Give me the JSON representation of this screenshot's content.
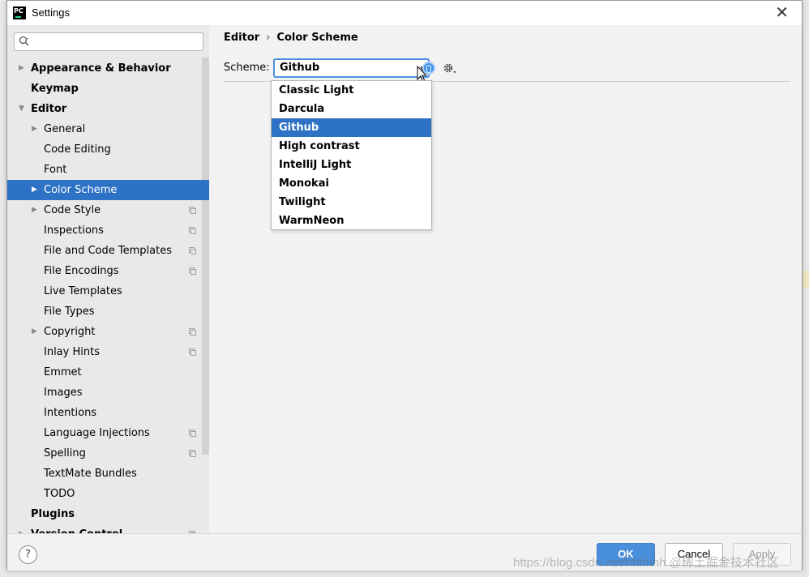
{
  "window": {
    "title": "Settings",
    "app_icon_text": "PC",
    "close_glyph": "✕"
  },
  "search": {
    "placeholder": "",
    "icon": "search-icon"
  },
  "tree": [
    {
      "label": "Appearance & Behavior",
      "bold": true,
      "arrow": "▶",
      "level": 0
    },
    {
      "label": "Keymap",
      "bold": true,
      "arrow": "",
      "level": 0
    },
    {
      "label": "Editor",
      "bold": true,
      "arrow": "▼",
      "level": 0
    },
    {
      "label": "General",
      "bold": false,
      "arrow": "▶",
      "level": 1
    },
    {
      "label": "Code Editing",
      "bold": false,
      "arrow": "",
      "level": 1
    },
    {
      "label": "Font",
      "bold": false,
      "arrow": "",
      "level": 1
    },
    {
      "label": "Color Scheme",
      "bold": false,
      "arrow": "▶",
      "level": 1,
      "selected": true
    },
    {
      "label": "Code Style",
      "bold": false,
      "arrow": "▶",
      "level": 1,
      "copy": true
    },
    {
      "label": "Inspections",
      "bold": false,
      "arrow": "",
      "level": 1,
      "copy": true
    },
    {
      "label": "File and Code Templates",
      "bold": false,
      "arrow": "",
      "level": 1,
      "copy": true
    },
    {
      "label": "File Encodings",
      "bold": false,
      "arrow": "",
      "level": 1,
      "copy": true
    },
    {
      "label": "Live Templates",
      "bold": false,
      "arrow": "",
      "level": 1
    },
    {
      "label": "File Types",
      "bold": false,
      "arrow": "",
      "level": 1
    },
    {
      "label": "Copyright",
      "bold": false,
      "arrow": "▶",
      "level": 1,
      "copy": true
    },
    {
      "label": "Inlay Hints",
      "bold": false,
      "arrow": "",
      "level": 1,
      "copy": true
    },
    {
      "label": "Emmet",
      "bold": false,
      "arrow": "",
      "level": 1
    },
    {
      "label": "Images",
      "bold": false,
      "arrow": "",
      "level": 1
    },
    {
      "label": "Intentions",
      "bold": false,
      "arrow": "",
      "level": 1
    },
    {
      "label": "Language Injections",
      "bold": false,
      "arrow": "",
      "level": 1,
      "copy": true
    },
    {
      "label": "Spelling",
      "bold": false,
      "arrow": "",
      "level": 1,
      "copy": true
    },
    {
      "label": "TextMate Bundles",
      "bold": false,
      "arrow": "",
      "level": 1
    },
    {
      "label": "TODO",
      "bold": false,
      "arrow": "",
      "level": 1
    },
    {
      "label": "Plugins",
      "bold": true,
      "arrow": "",
      "level": 0
    },
    {
      "label": "Version Control",
      "bold": true,
      "arrow": "▶",
      "level": 0,
      "copy": true
    }
  ],
  "breadcrumb": {
    "parent": "Editor",
    "separator": "›",
    "current": "Color Scheme"
  },
  "scheme": {
    "label": "Scheme:",
    "selected": "Github",
    "options": [
      "Classic Light",
      "Darcula",
      "Github",
      "High contrast",
      "IntelliJ Light",
      "Monokai",
      "Twilight",
      "WarmNeon"
    ],
    "selected_index": 2
  },
  "footer": {
    "help": "?",
    "ok": "OK",
    "cancel": "Cancel",
    "apply": "Apply"
  },
  "watermark": "https://blog.csdn.net/hhhhhh @稀土掘金技术社区",
  "colors": {
    "accent": "#2d72c4",
    "ok_button": "#4a8fdb",
    "focus": "#4a90e2"
  }
}
